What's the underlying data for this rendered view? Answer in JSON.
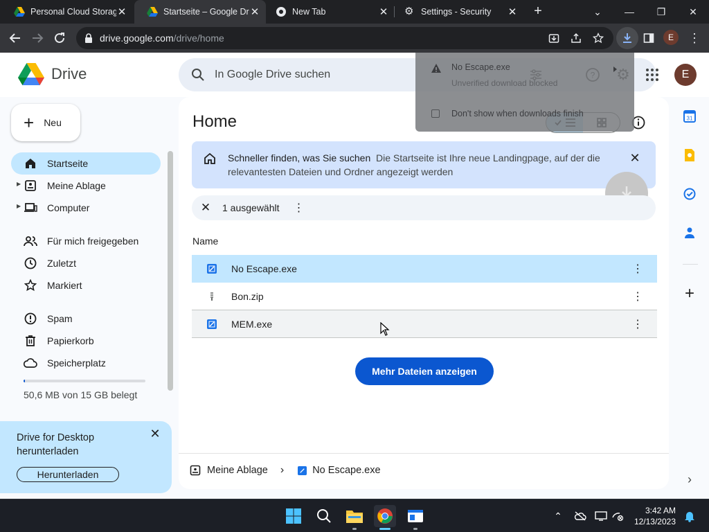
{
  "browser": {
    "tabs": [
      {
        "title": "Personal Cloud Storag",
        "favicon": "drive-icon",
        "active": false
      },
      {
        "title": "Startseite – Google Dr",
        "favicon": "drive-icon",
        "active": true
      },
      {
        "title": "New Tab",
        "favicon": "chrome-icon",
        "active": false
      },
      {
        "title": "Settings - Security",
        "favicon": "gear-icon",
        "active": false
      }
    ],
    "url_host": "drive.google.com",
    "url_path": "/drive/home",
    "profile_initial": "E"
  },
  "download_bubble": {
    "filename": "No Escape.exe",
    "status": "Unverified download blocked",
    "option_label": "Don't show when downloads finish"
  },
  "header": {
    "logo_text": "Drive",
    "search_placeholder": "In Google Drive suchen",
    "avatar_initial": "E"
  },
  "sidebar": {
    "new_label": "Neu",
    "items": [
      {
        "label": "Startseite",
        "icon": "home-icon",
        "active": true,
        "expandable": false
      },
      {
        "label": "Meine Ablage",
        "icon": "my-drive-icon",
        "active": false,
        "expandable": true
      },
      {
        "label": "Computer",
        "icon": "computer-icon",
        "active": false,
        "expandable": true
      },
      {
        "label": "Für mich freigegeben",
        "icon": "shared-icon",
        "active": false,
        "expandable": false
      },
      {
        "label": "Zuletzt",
        "icon": "clock-icon",
        "active": false,
        "expandable": false
      },
      {
        "label": "Markiert",
        "icon": "star-icon",
        "active": false,
        "expandable": false
      },
      {
        "label": "Spam",
        "icon": "spam-icon",
        "active": false,
        "expandable": false
      },
      {
        "label": "Papierkorb",
        "icon": "trash-icon",
        "active": false,
        "expandable": false
      },
      {
        "label": "Speicherplatz",
        "icon": "cloud-icon",
        "active": false,
        "expandable": false
      }
    ],
    "storage_text": "50,6 MB von 15 GB belegt",
    "storage_fraction": 0.004,
    "promo": {
      "text": "Drive for Desktop herunterladen",
      "button": "Herunterladen"
    }
  },
  "main": {
    "title": "Home",
    "banner": {
      "strong": "Schneller finden, was Sie suchen",
      "rest": "Die Startseite ist Ihre neue Landingpage, auf der die relevantesten Dateien und Ordner angezeigt werden"
    },
    "selection_text": "1 ausgewählt",
    "column_name": "Name",
    "files": [
      {
        "name": "No Escape.exe",
        "icon": "exe-file-icon",
        "state": "selected"
      },
      {
        "name": "Bon.zip",
        "icon": "zip-file-icon",
        "state": "normal"
      },
      {
        "name": "MEM.exe",
        "icon": "exe-file-icon",
        "state": "hover"
      }
    ],
    "more_files_label": "Mehr Dateien anzeigen",
    "breadcrumb": {
      "root": "Meine Ablage",
      "current": "No Escape.exe"
    }
  },
  "taskbar": {
    "time": "3:42 AM",
    "date": "12/13/2023"
  },
  "colors": {
    "accent": "#0b57d0",
    "selected": "#c2e7ff",
    "banner": "#d3e3fd"
  }
}
